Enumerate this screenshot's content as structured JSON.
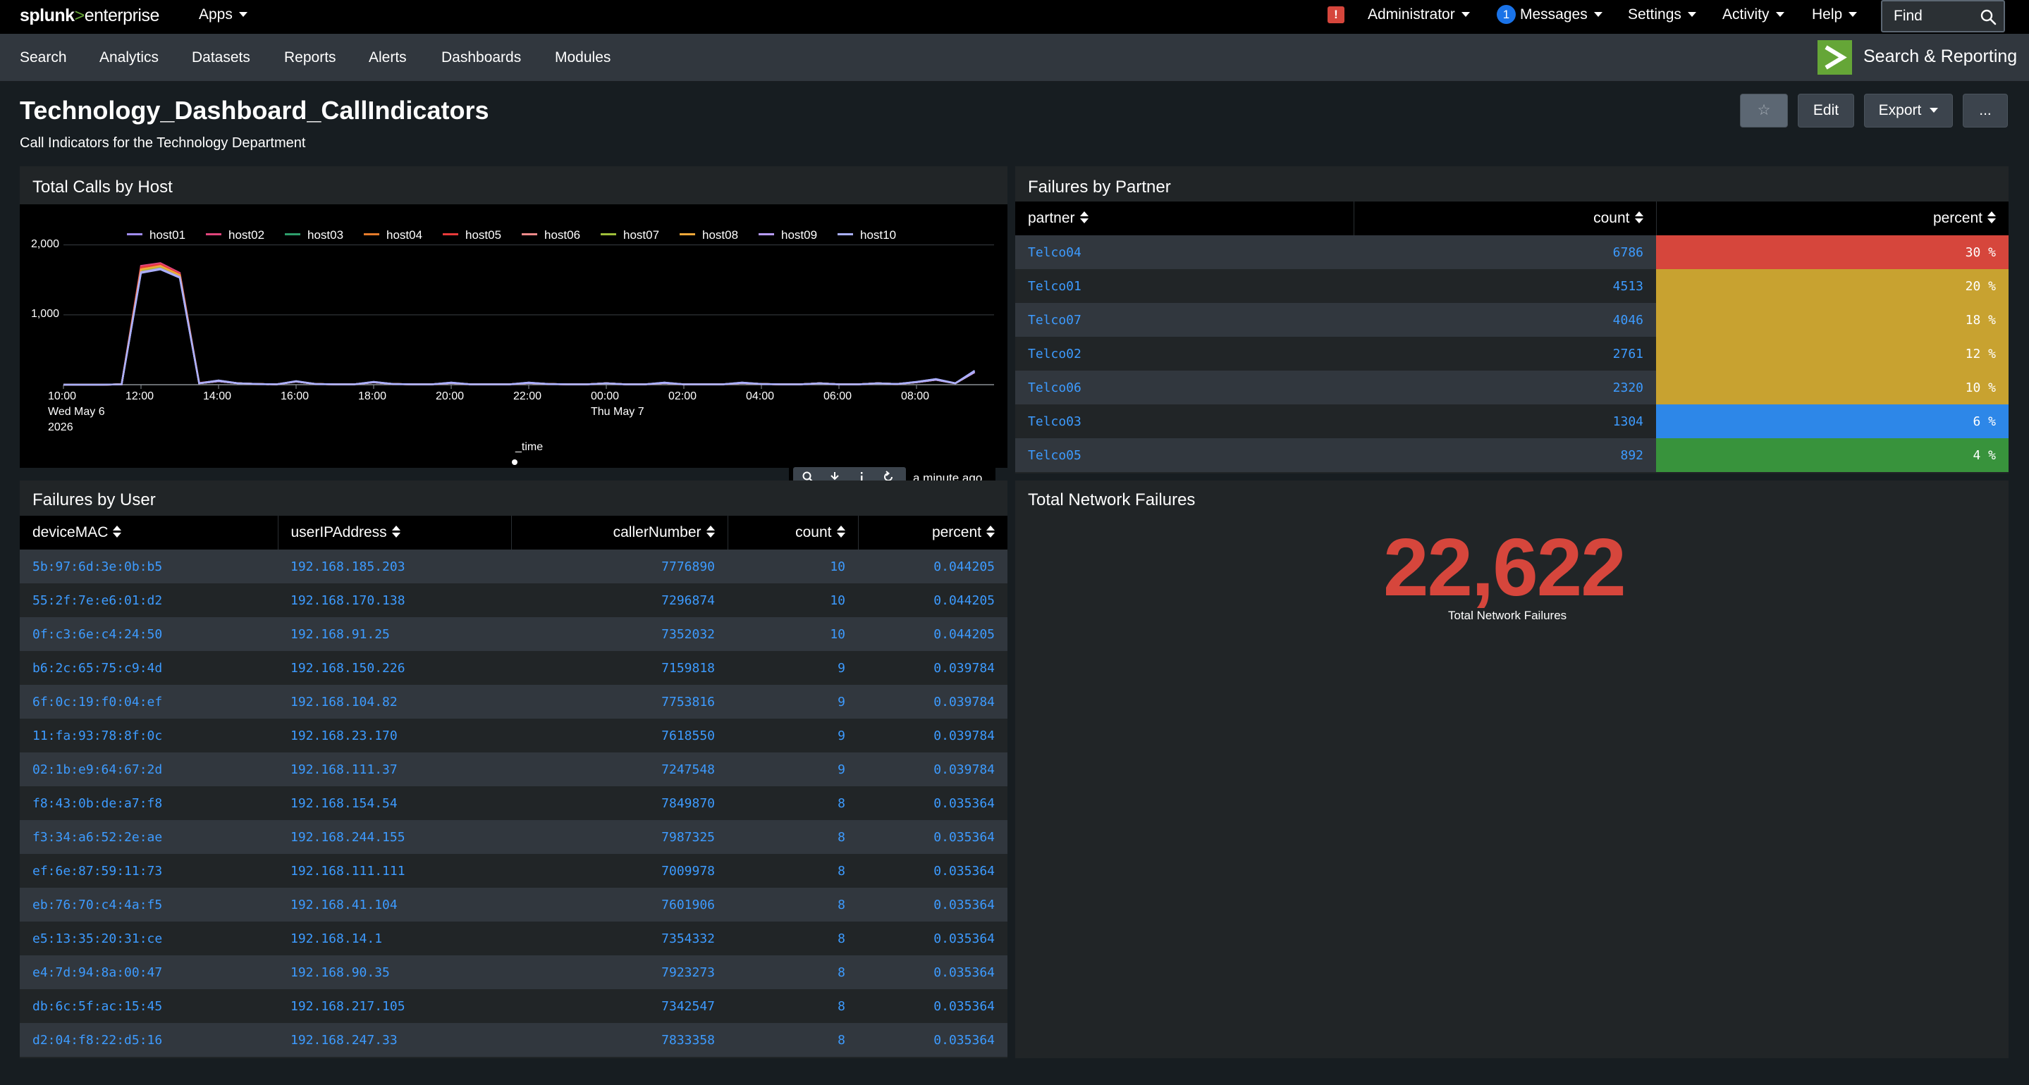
{
  "topbar": {
    "logo_splunk": "splunk",
    "logo_gt": ">",
    "logo_enterprise": "enterprise",
    "apps": "Apps",
    "alert_badge": "!",
    "administrator": "Administrator",
    "messages_count": "1",
    "messages": "Messages",
    "settings": "Settings",
    "activity": "Activity",
    "help": "Help",
    "find_placeholder": "Find"
  },
  "nav": {
    "items": [
      "Search",
      "Analytics",
      "Datasets",
      "Reports",
      "Alerts",
      "Dashboards",
      "Modules"
    ],
    "app_title": "Search & Reporting"
  },
  "page": {
    "title": "Technology_Dashboard_CallIndicators",
    "description": "Call Indicators for the Technology Department",
    "buttons": {
      "star": "☆",
      "edit": "Edit",
      "export": "Export",
      "more": "..."
    }
  },
  "panels": {
    "calls_by_host": {
      "title": "Total Calls by Host",
      "toolbar_time": "a minute ago"
    },
    "failures_by_partner": {
      "title": "Failures by Partner",
      "columns": [
        "partner",
        "count",
        "percent"
      ],
      "rows": [
        {
          "partner": "Telco04",
          "count": "6786",
          "percent": "30 %",
          "color": "#d6463c"
        },
        {
          "partner": "Telco01",
          "count": "4513",
          "percent": "20 %",
          "color": "#c8a230"
        },
        {
          "partner": "Telco07",
          "count": "4046",
          "percent": "18 %",
          "color": "#c8a230"
        },
        {
          "partner": "Telco02",
          "count": "2761",
          "percent": "12 %",
          "color": "#c8a230"
        },
        {
          "partner": "Telco06",
          "count": "2320",
          "percent": "10 %",
          "color": "#c8a230"
        },
        {
          "partner": "Telco03",
          "count": "1304",
          "percent": "6 %",
          "color": "#2d87e8"
        },
        {
          "partner": "Telco05",
          "count": "892",
          "percent": "4 %",
          "color": "#38933c"
        }
      ]
    },
    "failures_by_user": {
      "title": "Failures by User",
      "columns": [
        "deviceMAC",
        "userIPAddress",
        "callerNumber",
        "count",
        "percent"
      ],
      "rows": [
        [
          "5b:97:6d:3e:0b:b5",
          "192.168.185.203",
          "7776890",
          "10",
          "0.044205"
        ],
        [
          "55:2f:7e:e6:01:d2",
          "192.168.170.138",
          "7296874",
          "10",
          "0.044205"
        ],
        [
          "0f:c3:6e:c4:24:50",
          "192.168.91.25",
          "7352032",
          "10",
          "0.044205"
        ],
        [
          "b6:2c:65:75:c9:4d",
          "192.168.150.226",
          "7159818",
          "9",
          "0.039784"
        ],
        [
          "6f:0c:19:f0:04:ef",
          "192.168.104.82",
          "7753816",
          "9",
          "0.039784"
        ],
        [
          "11:fa:93:78:8f:0c",
          "192.168.23.170",
          "7618550",
          "9",
          "0.039784"
        ],
        [
          "02:1b:e9:64:67:2d",
          "192.168.111.37",
          "7247548",
          "9",
          "0.039784"
        ],
        [
          "f8:43:0b:de:a7:f8",
          "192.168.154.54",
          "7849870",
          "8",
          "0.035364"
        ],
        [
          "f3:34:a6:52:2e:ae",
          "192.168.244.155",
          "7987325",
          "8",
          "0.035364"
        ],
        [
          "ef:6e:87:59:11:73",
          "192.168.111.111",
          "7009978",
          "8",
          "0.035364"
        ],
        [
          "eb:76:70:c4:4a:f5",
          "192.168.41.104",
          "7601906",
          "8",
          "0.035364"
        ],
        [
          "e5:13:35:20:31:ce",
          "192.168.14.1",
          "7354332",
          "8",
          "0.035364"
        ],
        [
          "e4:7d:94:8a:00:47",
          "192.168.90.35",
          "7923273",
          "8",
          "0.035364"
        ],
        [
          "db:6c:5f:ac:15:45",
          "192.168.217.105",
          "7342547",
          "8",
          "0.035364"
        ],
        [
          "d2:04:f8:22:d5:16",
          "192.168.247.33",
          "7833358",
          "8",
          "0.035364"
        ]
      ]
    },
    "total_network_failures": {
      "title": "Total Network Failures",
      "value": "22,622",
      "label": "Total Network Failures",
      "color": "#d6463c"
    }
  },
  "chart_data": {
    "type": "line",
    "xlabel": "_time",
    "ylabel": "",
    "ylim": [
      0,
      2400
    ],
    "yticks": [
      "2,000",
      "1,000"
    ],
    "ytick_values": [
      2000,
      1000
    ],
    "xticks": [
      {
        "t": 0,
        "label": "10:00",
        "sub1": "Wed May 6",
        "sub2": "2026"
      },
      {
        "t": 2,
        "label": "12:00"
      },
      {
        "t": 4,
        "label": "14:00"
      },
      {
        "t": 6,
        "label": "16:00"
      },
      {
        "t": 8,
        "label": "18:00"
      },
      {
        "t": 10,
        "label": "20:00"
      },
      {
        "t": 12,
        "label": "22:00"
      },
      {
        "t": 14,
        "label": "00:00",
        "sub1": "Thu May 7"
      },
      {
        "t": 16,
        "label": "02:00"
      },
      {
        "t": 18,
        "label": "04:00"
      },
      {
        "t": 20,
        "label": "06:00"
      },
      {
        "t": 22,
        "label": "08:00"
      }
    ],
    "x": [
      0,
      0.5,
      1,
      1.5,
      2,
      2.5,
      3,
      3.5,
      4,
      4.5,
      5,
      5.5,
      6,
      6.5,
      7,
      7.5,
      8,
      8.5,
      9,
      9.5,
      10,
      10.5,
      11,
      11.5,
      12,
      12.5,
      13,
      13.5,
      14,
      14.5,
      15,
      15.5,
      16,
      16.5,
      17,
      17.5,
      18,
      18.5,
      19,
      19.5,
      20,
      20.5,
      21,
      21.5,
      22,
      22.5,
      23,
      23.5
    ],
    "xmax": 24,
    "series": [
      {
        "name": "host01",
        "color": "#a08cf0",
        "values": [
          0,
          0,
          0,
          5,
          1620,
          1680,
          1550,
          20,
          60,
          20,
          10,
          5,
          50,
          10,
          5,
          5,
          40,
          10,
          5,
          5,
          30,
          5,
          5,
          5,
          30,
          10,
          5,
          5,
          20,
          5,
          5,
          30,
          5,
          5,
          5,
          30,
          10,
          5,
          5,
          20,
          5,
          5,
          20,
          10,
          40,
          80,
          20,
          200
        ]
      },
      {
        "name": "host02",
        "color": "#e0457b",
        "values": [
          0,
          0,
          0,
          5,
          1700,
          1740,
          1600,
          25,
          55,
          20,
          10,
          5,
          45,
          10,
          5,
          5,
          35,
          10,
          5,
          5,
          25,
          5,
          5,
          5,
          25,
          10,
          5,
          5,
          20,
          5,
          5,
          25,
          5,
          5,
          5,
          25,
          10,
          5,
          5,
          20,
          5,
          5,
          20,
          10,
          35,
          70,
          20,
          180
        ]
      },
      {
        "name": "host03",
        "color": "#2e9e6b",
        "values": [
          0,
          0,
          0,
          5,
          1650,
          1700,
          1570,
          20,
          50,
          20,
          10,
          5,
          45,
          10,
          5,
          5,
          35,
          10,
          5,
          5,
          25,
          5,
          5,
          5,
          25,
          10,
          5,
          5,
          20,
          5,
          5,
          25,
          5,
          5,
          5,
          25,
          10,
          5,
          5,
          20,
          5,
          5,
          20,
          10,
          35,
          70,
          20,
          180
        ]
      },
      {
        "name": "host04",
        "color": "#e57b2b",
        "values": [
          0,
          0,
          0,
          5,
          1660,
          1690,
          1560,
          20,
          50,
          20,
          10,
          5,
          45,
          10,
          5,
          5,
          35,
          10,
          5,
          5,
          25,
          5,
          5,
          5,
          25,
          10,
          5,
          5,
          20,
          5,
          5,
          25,
          5,
          5,
          5,
          25,
          10,
          5,
          5,
          20,
          5,
          5,
          20,
          10,
          35,
          70,
          20,
          180
        ]
      },
      {
        "name": "host05",
        "color": "#e83a3a",
        "values": [
          0,
          0,
          0,
          5,
          1680,
          1720,
          1580,
          20,
          50,
          20,
          10,
          5,
          45,
          10,
          5,
          5,
          35,
          10,
          5,
          5,
          25,
          5,
          5,
          5,
          25,
          10,
          5,
          5,
          20,
          5,
          5,
          25,
          5,
          5,
          5,
          25,
          10,
          5,
          5,
          20,
          5,
          5,
          20,
          10,
          35,
          70,
          20,
          180
        ]
      },
      {
        "name": "host06",
        "color": "#f08a8a",
        "values": [
          0,
          0,
          0,
          5,
          1640,
          1700,
          1560,
          20,
          50,
          20,
          10,
          5,
          45,
          10,
          5,
          5,
          35,
          10,
          5,
          5,
          25,
          5,
          5,
          5,
          25,
          10,
          5,
          5,
          20,
          5,
          5,
          25,
          5,
          5,
          5,
          25,
          10,
          5,
          5,
          20,
          5,
          5,
          20,
          10,
          35,
          70,
          20,
          180
        ]
      },
      {
        "name": "host07",
        "color": "#9fbf3a",
        "values": [
          0,
          0,
          0,
          5,
          1630,
          1690,
          1560,
          20,
          50,
          20,
          10,
          5,
          45,
          10,
          5,
          5,
          35,
          10,
          5,
          5,
          25,
          5,
          5,
          5,
          25,
          10,
          5,
          5,
          20,
          5,
          5,
          25,
          5,
          5,
          5,
          25,
          10,
          5,
          5,
          20,
          5,
          5,
          20,
          10,
          35,
          70,
          20,
          180
        ]
      },
      {
        "name": "host08",
        "color": "#f0a83a",
        "values": [
          0,
          0,
          0,
          5,
          1650,
          1700,
          1570,
          20,
          50,
          20,
          10,
          5,
          45,
          10,
          5,
          5,
          35,
          10,
          5,
          5,
          25,
          5,
          5,
          5,
          25,
          10,
          5,
          5,
          20,
          5,
          5,
          25,
          5,
          5,
          5,
          25,
          10,
          5,
          5,
          20,
          5,
          5,
          20,
          10,
          35,
          70,
          20,
          180
        ]
      },
      {
        "name": "host09",
        "color": "#b89cff",
        "values": [
          0,
          0,
          0,
          5,
          1610,
          1660,
          1540,
          20,
          50,
          20,
          10,
          5,
          45,
          10,
          5,
          5,
          35,
          10,
          5,
          5,
          25,
          5,
          5,
          5,
          25,
          10,
          5,
          5,
          20,
          5,
          5,
          25,
          5,
          5,
          5,
          25,
          10,
          5,
          5,
          20,
          5,
          5,
          20,
          10,
          35,
          70,
          20,
          180
        ]
      },
      {
        "name": "host10",
        "color": "#aab0ff",
        "values": [
          0,
          0,
          0,
          5,
          1600,
          1650,
          1530,
          20,
          60,
          20,
          10,
          5,
          50,
          10,
          5,
          5,
          40,
          10,
          5,
          5,
          30,
          5,
          5,
          5,
          30,
          10,
          5,
          5,
          20,
          5,
          5,
          30,
          5,
          5,
          5,
          30,
          10,
          5,
          5,
          20,
          5,
          5,
          20,
          10,
          40,
          80,
          20,
          200
        ]
      }
    ]
  }
}
